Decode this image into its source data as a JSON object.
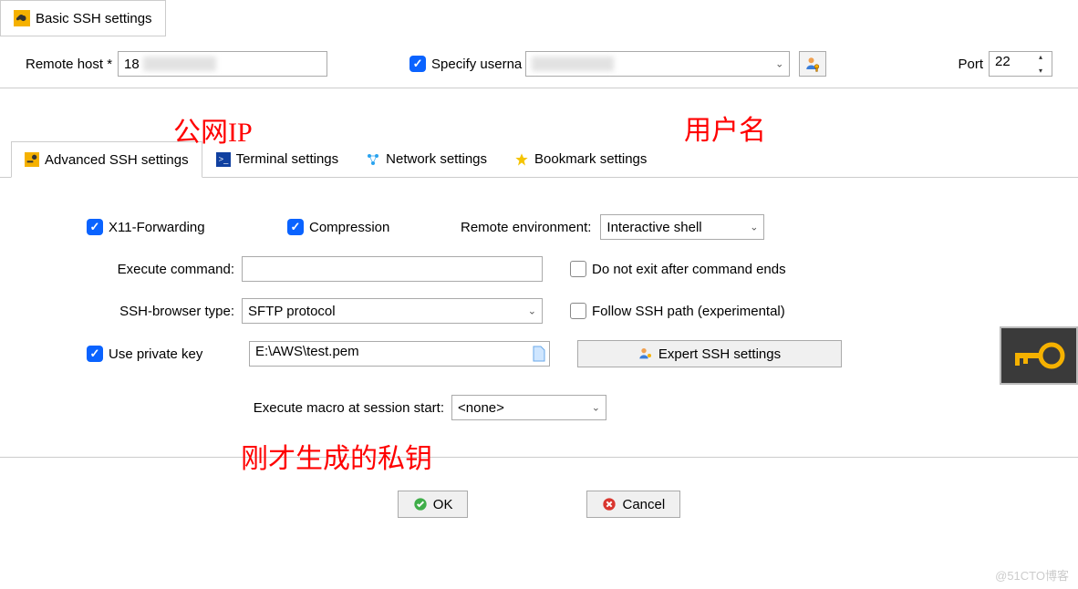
{
  "basic_tab": {
    "label": "Basic SSH settings"
  },
  "remote_host": {
    "label": "Remote host *",
    "value_prefix": "18"
  },
  "specify_username": {
    "label": "Specify userna",
    "checked": true
  },
  "port": {
    "label": "Port",
    "value": "22"
  },
  "tabs": {
    "advanced": "Advanced SSH settings",
    "terminal": "Terminal settings",
    "network": "Network settings",
    "bookmark": "Bookmark settings"
  },
  "adv": {
    "x11": {
      "label": "X11-Forwarding",
      "checked": true
    },
    "compression": {
      "label": "Compression",
      "checked": true
    },
    "remote_env": {
      "label": "Remote environment:",
      "value": "Interactive shell"
    },
    "exec_cmd": {
      "label": "Execute command:",
      "value": ""
    },
    "no_exit": {
      "label": "Do not exit after command ends",
      "checked": false
    },
    "ssh_browser": {
      "label": "SSH-browser type:",
      "value": "SFTP protocol"
    },
    "follow_ssh": {
      "label": "Follow SSH path (experimental)",
      "checked": false
    },
    "use_pk": {
      "label": "Use private key",
      "checked": true,
      "value": "E:\\AWS\\test.pem"
    },
    "expert_btn": "Expert SSH settings",
    "exec_macro": {
      "label": "Execute macro at session start:",
      "value": "<none>"
    }
  },
  "buttons": {
    "ok": "OK",
    "cancel": "Cancel"
  },
  "annotations": {
    "public_ip": "公网IP",
    "username": "用户名",
    "private_key": "刚才生成的私钥"
  },
  "watermark": "@51CTO博客"
}
